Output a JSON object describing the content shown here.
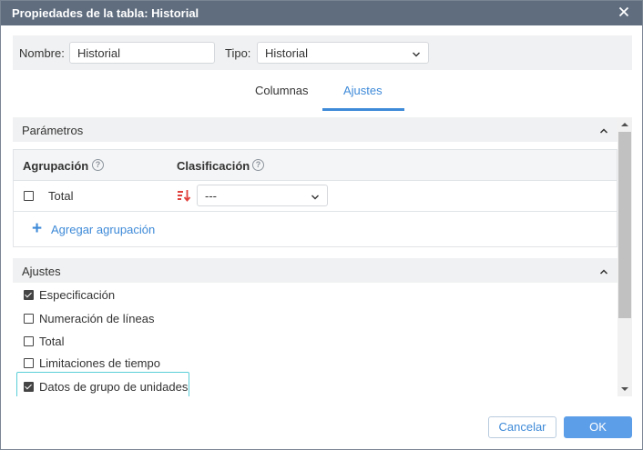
{
  "dialog": {
    "title": "Propiedades de la tabla: Historial",
    "name_label": "Nombre:",
    "name_value": "Historial",
    "type_label": "Tipo:",
    "type_value": "Historial"
  },
  "tabs": [
    {
      "label": "Columnas",
      "active": false
    },
    {
      "label": "Ajustes",
      "active": true
    }
  ],
  "parametros": {
    "header": "Parámetros",
    "grouping_header": "Agrupación",
    "sort_header": "Clasificación",
    "rows": [
      {
        "label": "Total",
        "checked": false,
        "sort_value": "---"
      }
    ],
    "add_label": "Agregar agrupación"
  },
  "ajustes": {
    "header": "Ajustes",
    "items": [
      {
        "label": "Especificación",
        "checked": true
      },
      {
        "label": "Numeración de líneas",
        "checked": false
      },
      {
        "label": "Total",
        "checked": false
      },
      {
        "label": "Limitaciones de tiempo",
        "checked": false
      },
      {
        "label": "Datos de grupo de unidades",
        "checked": true
      }
    ]
  },
  "footer": {
    "cancel_label": "Cancelar",
    "ok_label": "OK"
  },
  "colors": {
    "accent": "#3e8ad8",
    "titlebar": "#5f6d7f",
    "focus_outline": "#5ccfd8",
    "sort_icon": "#e0403c"
  }
}
